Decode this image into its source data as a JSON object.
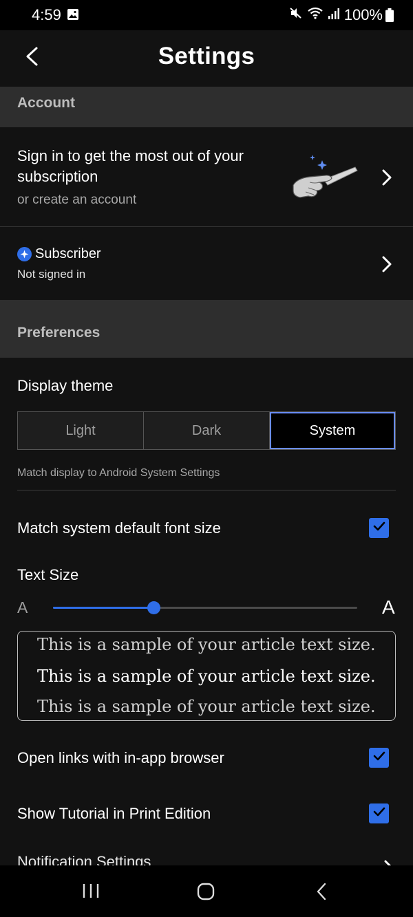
{
  "status_bar": {
    "time": "4:59",
    "battery": "100%"
  },
  "header": {
    "title": "Settings"
  },
  "account": {
    "section_title": "Account",
    "signin_title": "Sign in to get the most out of your subscription",
    "signin_subtitle": "or create an account",
    "subscriber_label": "Subscriber",
    "subscriber_status": "Not signed in"
  },
  "preferences": {
    "section_title": "Preferences",
    "display_theme_label": "Display theme",
    "theme_options": [
      "Light",
      "Dark",
      "System"
    ],
    "selected_theme": "System",
    "theme_description": "Match display to Android System Settings",
    "match_font_label": "Match system default font size",
    "match_font_checked": true,
    "text_size_label": "Text Size",
    "text_size_small_glyph": "A",
    "text_size_large_glyph": "A",
    "text_size_level": 0.33,
    "sample_text": "This is a sample of your article text size.",
    "open_links_label": "Open links with in-app browser",
    "open_links_checked": true,
    "tutorial_label": "Show Tutorial in Print Edition",
    "tutorial_checked": true,
    "notifications_label": "Notification Settings"
  },
  "colors": {
    "accent": "#2f6ee8",
    "background": "#121212",
    "section_bg": "#2e2e2e"
  },
  "icons": {
    "back": "chevron-left-icon",
    "row_chevron": "chevron-right-icon",
    "subscriber_badge": "sparkle-badge-icon",
    "checkbox": "check-icon"
  }
}
